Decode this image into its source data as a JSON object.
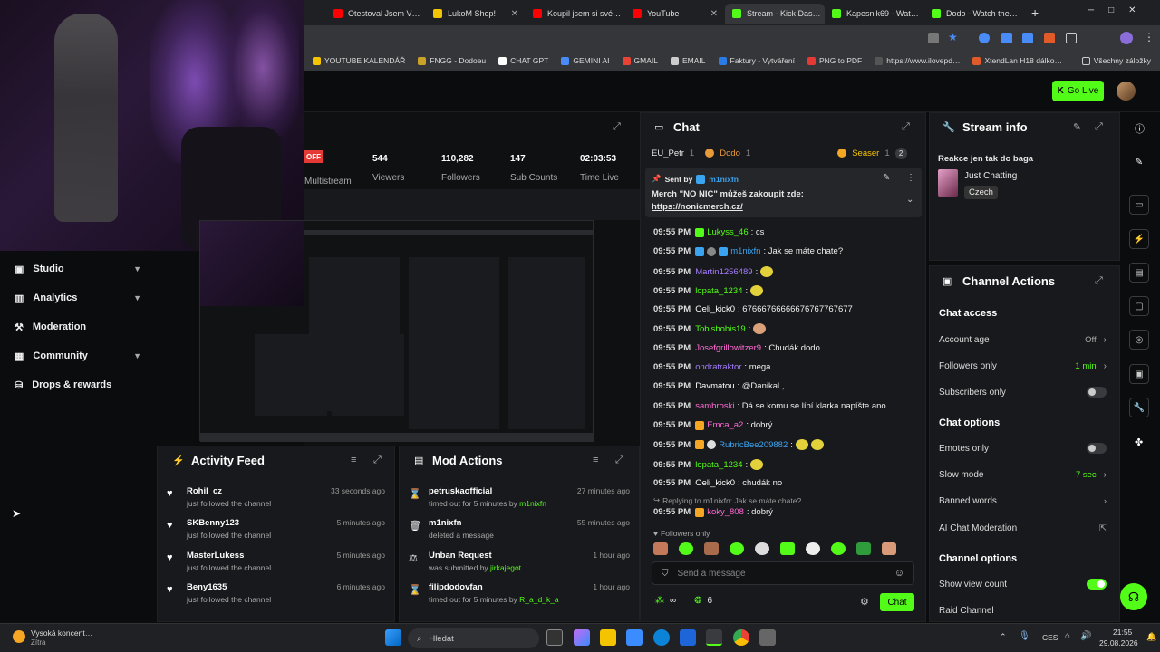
{
  "browser": {
    "tabs": [
      {
        "label": "Otestoval Jsem V…",
        "color": "#ff0000"
      },
      {
        "label": "LukoM Shop!",
        "color": "#f5c400"
      },
      {
        "label": "Koupil jsem si své…",
        "color": "#ff0000"
      },
      {
        "label": "YouTube",
        "color": "#ff0000"
      },
      {
        "label": "Stream - Kick Das…",
        "color": "#53fc18"
      },
      {
        "label": "Kapesnik69 - Wat…",
        "color": "#53fc18"
      },
      {
        "label": "Dodo - Watch the…",
        "color": "#53fc18"
      }
    ],
    "bookmarks": [
      "YOUTUBE KALENDÁŘ",
      "FNGG - Dodoeu",
      "CHAT GPT",
      "GEMINI AI",
      "GMAIL",
      "EMAIL",
      "Faktury - Vytváření",
      "PNG to PDF",
      "https://www.ilovepd…",
      "XtendLan H18 dálko…"
    ],
    "all_bookmarks": "Všechny záložky"
  },
  "header": {
    "go_live": "Go Live"
  },
  "sidebar": {
    "items": [
      {
        "label": "Studio",
        "icon": "studio-icon"
      },
      {
        "label": "Analytics",
        "icon": "analytics-icon"
      },
      {
        "label": "Moderation",
        "icon": "moderation-icon"
      },
      {
        "label": "Community",
        "icon": "community-icon"
      },
      {
        "label": "Drops & rewards",
        "icon": "drops-icon"
      }
    ]
  },
  "stats": {
    "status": "OFF",
    "status_label": "Multistream",
    "viewers": "544",
    "viewers_label": "Viewers",
    "followers": "110,282",
    "followers_label": "Followers",
    "subs": "147",
    "subs_label": "Sub Counts",
    "time": "02:03:53",
    "time_label": "Time Live"
  },
  "activity": {
    "title": "Activity Feed",
    "items": [
      {
        "name": "Rohil_cz",
        "sub": "just followed the channel",
        "time": "33 seconds ago"
      },
      {
        "name": "SKBenny123",
        "sub": "just followed the channel",
        "time": "5 minutes ago"
      },
      {
        "name": "MasterLukess",
        "sub": "just followed the channel",
        "time": "5 minutes ago"
      },
      {
        "name": "Beny1635",
        "sub": "just followed the channel",
        "time": "6 minutes ago"
      }
    ]
  },
  "mod": {
    "title": "Mod Actions",
    "items": [
      {
        "name": "petruskaofficial",
        "sub": "timed out for 5 minutes by ",
        "by": "m1nixfn",
        "time": "27 minutes ago"
      },
      {
        "name": "m1nixfn",
        "sub": "deleted a message",
        "by": "",
        "time": "55 minutes ago"
      },
      {
        "name": "Unban Request",
        "sub": "was submitted by ",
        "by": "jirkajegot",
        "time": "1 hour ago"
      },
      {
        "name": "filipdodovfan",
        "sub": "timed out for 5 minutes by ",
        "by": "R_a_d_k_a",
        "time": "1 hour ago"
      }
    ]
  },
  "chat": {
    "title": "Chat",
    "top_users": [
      {
        "name": "EU_Petr",
        "n": "1"
      },
      {
        "name": "Dodo",
        "n": "1"
      },
      {
        "name": "Seaser",
        "n": "1"
      }
    ],
    "more_count": "2",
    "pinned_by_label": "Sent by",
    "pinned_by": "m1nixfn",
    "pinned_text": "Merch \"NO NIC\" můžeš zakoupit zde:",
    "pinned_link": "https://nonicmerch.cz/",
    "messages": [
      {
        "time": "09:55 PM",
        "user": "Lukyss_46",
        "color": "#53fc18",
        "text": ": cs"
      },
      {
        "time": "09:55 PM",
        "user": "m1nixfn",
        "color": "#3ba4f0",
        "text": ": Jak se máte chate?"
      },
      {
        "time": "09:55 PM",
        "user": "Martin1256489",
        "color": "#a57cff",
        "text": ":"
      },
      {
        "time": "09:55 PM",
        "user": "lopata_1234",
        "color": "#53fc18",
        "text": ":"
      },
      {
        "time": "09:55 PM",
        "user": "Oeli_kick0",
        "color": "#ffffff",
        "text": ": 67666766666676767767677"
      },
      {
        "time": "09:55 PM",
        "user": "Tobisbobis19",
        "color": "#53fc18",
        "text": ":"
      },
      {
        "time": "09:55 PM",
        "user": "Josefgrillowitzer9",
        "color": "#ff6ad5",
        "text": ": Chudák dodo"
      },
      {
        "time": "09:55 PM",
        "user": "ondratraktor",
        "color": "#a57cff",
        "text": ": mega"
      },
      {
        "time": "09:55 PM",
        "user": "Davmatou",
        "color": "#ffffff",
        "text": ": @Danikal ,"
      },
      {
        "time": "09:55 PM",
        "user": "sambroski",
        "color": "#ff6ad5",
        "text": ": Dá se komu se líbí klarka napíšte ano"
      },
      {
        "time": "09:55 PM",
        "user": "Emca_a2",
        "color": "#ff6ad5",
        "text": ": dobrý"
      },
      {
        "time": "09:55 PM",
        "user": "RubricBee209882",
        "color": "#3ba4f0",
        "text": ":"
      },
      {
        "time": "09:55 PM",
        "user": "lopata_1234",
        "color": "#53fc18",
        "text": ":"
      },
      {
        "time": "09:55 PM",
        "user": "Oeli_kick0",
        "color": "#ffffff",
        "text": ": chudák no"
      }
    ],
    "reply_hint": "Replying to m1nixfn: Jak se máte chate?",
    "reply_msg": {
      "time": "09:55 PM",
      "user": "koky_808",
      "text": ": dobrý"
    },
    "followers_only": "Followers only",
    "input_placeholder": "Send a message",
    "infinity": "∞",
    "points": "6",
    "send": "Chat"
  },
  "stream_info": {
    "title": "Stream info",
    "stream_title": "Reakce jen tak do baga",
    "category": "Just Chatting",
    "language": "Czech"
  },
  "channel_actions": {
    "title": "Channel Actions",
    "chat_access": "Chat access",
    "account_age": "Account age",
    "account_age_val": "Off",
    "followers_only": "Followers only",
    "followers_only_val": "1 min",
    "subscribers_only": "Subscribers only",
    "chat_options": "Chat options",
    "emotes_only": "Emotes only",
    "slow_mode": "Slow mode",
    "slow_mode_val": "7 sec",
    "banned_words": "Banned words",
    "ai_mod": "AI Chat Moderation",
    "channel_options": "Channel options",
    "show_view_count": "Show view count",
    "raid_channel": "Raid Channel"
  },
  "taskbar": {
    "weather": "Vysoká koncent…",
    "weather_sub": "Zítra",
    "search": "Hledat",
    "lang": "CES",
    "time": "21:55",
    "date": "29.08.2026"
  }
}
